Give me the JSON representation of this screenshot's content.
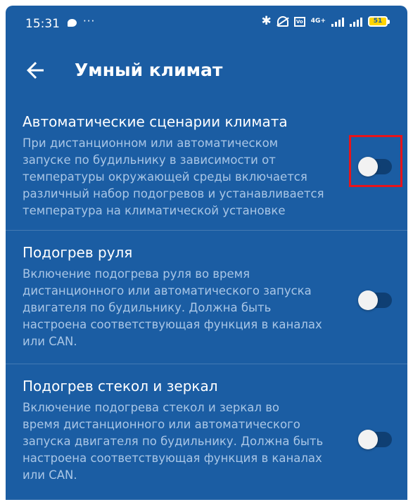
{
  "status_bar": {
    "time": "15:31",
    "dots": "···",
    "net_label": "4G+",
    "sim_label": "Vo",
    "battery_level": "51"
  },
  "app_bar": {
    "title": "Умный климат"
  },
  "settings": [
    {
      "title": "Автоматические сценарии климата",
      "description": "При дистанционном или автоматическом\nзапуске по будильнику в зависимости от\nтемпературы окружающей среды включается\nразличный набор подогревов и устанавливается\nтемпература на климатической установке",
      "enabled": false
    },
    {
      "title": "Подогрев руля",
      "description": "Включение подогрева руля во время\nдистанционного или автоматического запуска\nдвигателя по будильнику. Должна быть\nнастроена соответствующая функция в каналах\nили CAN.",
      "enabled": false
    },
    {
      "title": "Подогрев стекол и зеркал",
      "description": "Включение подогрева стекол и зеркал во\nвремя дистанционного или автоматического\nзапуска двигателя по будильнику. Должна быть\nнастроена соответствующая функция в каналах\nили CAN.",
      "enabled": false
    }
  ],
  "colors": {
    "background": "#1b5da3",
    "description_text": "#a9c6e6",
    "highlight": "#e8141a",
    "battery": "#ffd400"
  },
  "icons": {
    "back": "arrow-left-icon",
    "bluetooth": "bluetooth-icon",
    "mute": "bell-off-icon"
  }
}
